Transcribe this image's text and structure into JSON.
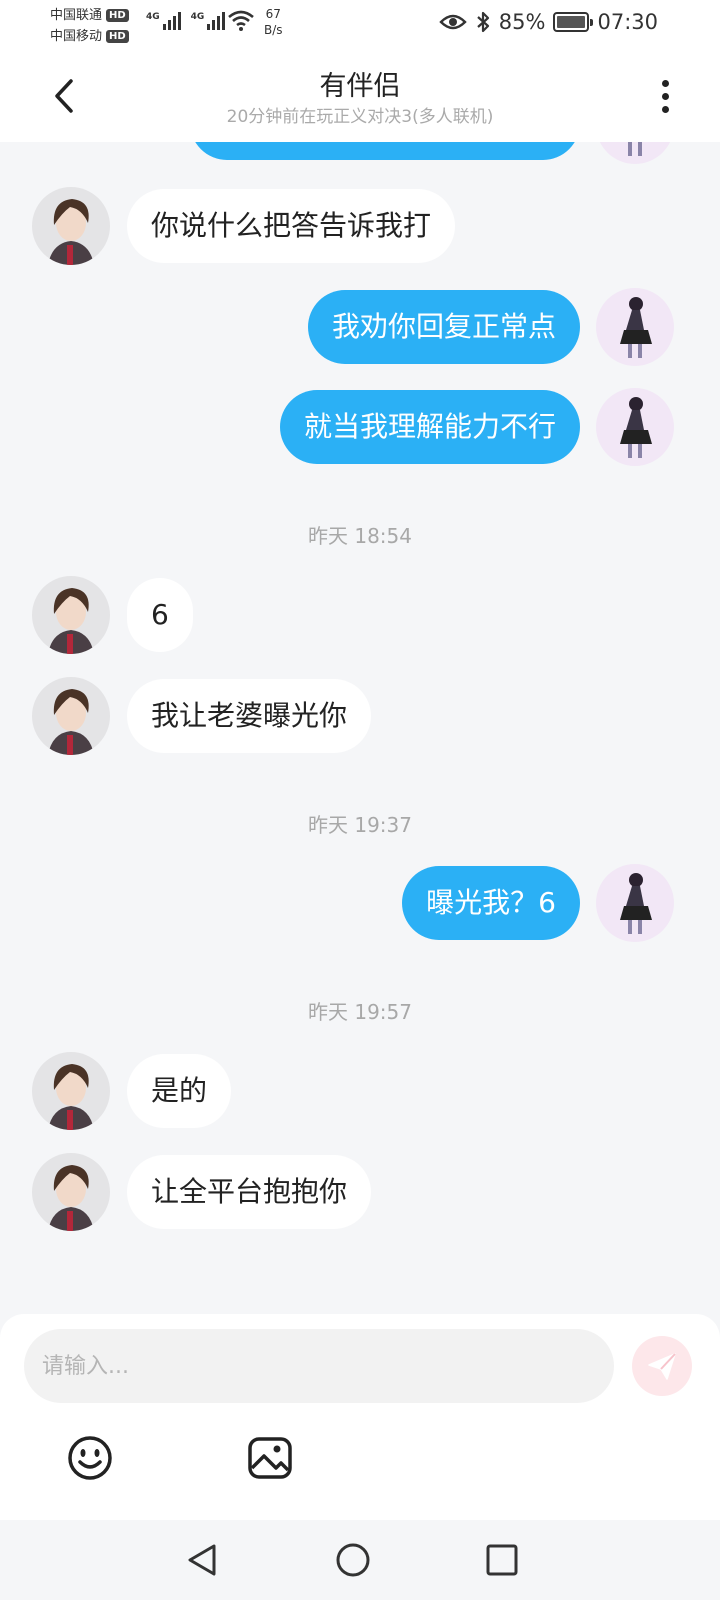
{
  "status_bar": {
    "carrier1": "中国联通",
    "carrier2": "中国移动",
    "hd": "HD",
    "network": "4G",
    "speed_value": "67",
    "speed_unit": "B/s",
    "battery": "85%",
    "time": "07:30"
  },
  "header": {
    "title": "有伴侣",
    "subtitle": "20分钟前在玩正义对决3(多人联机)"
  },
  "messages": [
    {
      "from": "peer",
      "text": "你说什么把答告诉我打"
    },
    {
      "from": "me",
      "text": "我劝你回复正常点"
    },
    {
      "from": "me",
      "text": "就当我理解能力不行"
    },
    {
      "time": "昨天 18:54"
    },
    {
      "from": "peer",
      "text": "6"
    },
    {
      "from": "peer",
      "text": "我让老婆曝光你"
    },
    {
      "time": "昨天 19:37"
    },
    {
      "from": "me",
      "text": "曝光我？6"
    },
    {
      "time": "昨天 19:57"
    },
    {
      "from": "peer",
      "text": "是的"
    },
    {
      "from": "peer",
      "text": "让全平台抱抱你"
    }
  ],
  "input": {
    "placeholder": "请输入..."
  },
  "colors": {
    "outgoing_bubble": "#2bb0f5",
    "incoming_bubble": "#ffffff",
    "background": "#f5f6f8",
    "send_button": "#fde7ea"
  }
}
